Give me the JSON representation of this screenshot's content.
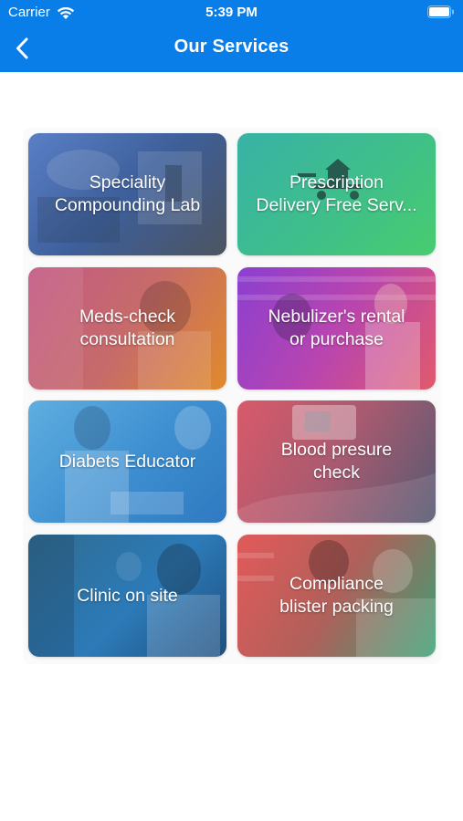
{
  "status_bar": {
    "carrier": "Carrier",
    "time": "5:39 PM",
    "icons": [
      "wifi-icon",
      "battery-icon"
    ]
  },
  "nav": {
    "back_icon": "chevron-left-icon",
    "title": "Our Services"
  },
  "colors": {
    "header_bg": "#0a7ee8",
    "header_text": "#ffffff",
    "card_text": "#ffffff"
  },
  "services": [
    {
      "label": "Speciality\nCompounding Lab"
    },
    {
      "label": "Prescription\nDelivery Free Serv..."
    },
    {
      "label": "Meds-check\nconsultation"
    },
    {
      "label": "Nebulizer's rental\nor purchase"
    },
    {
      "label": "Diabets Educator"
    },
    {
      "label": "Blood presure\ncheck"
    },
    {
      "label": "Clinic on site"
    },
    {
      "label": "Compliance\nblister packing"
    }
  ]
}
